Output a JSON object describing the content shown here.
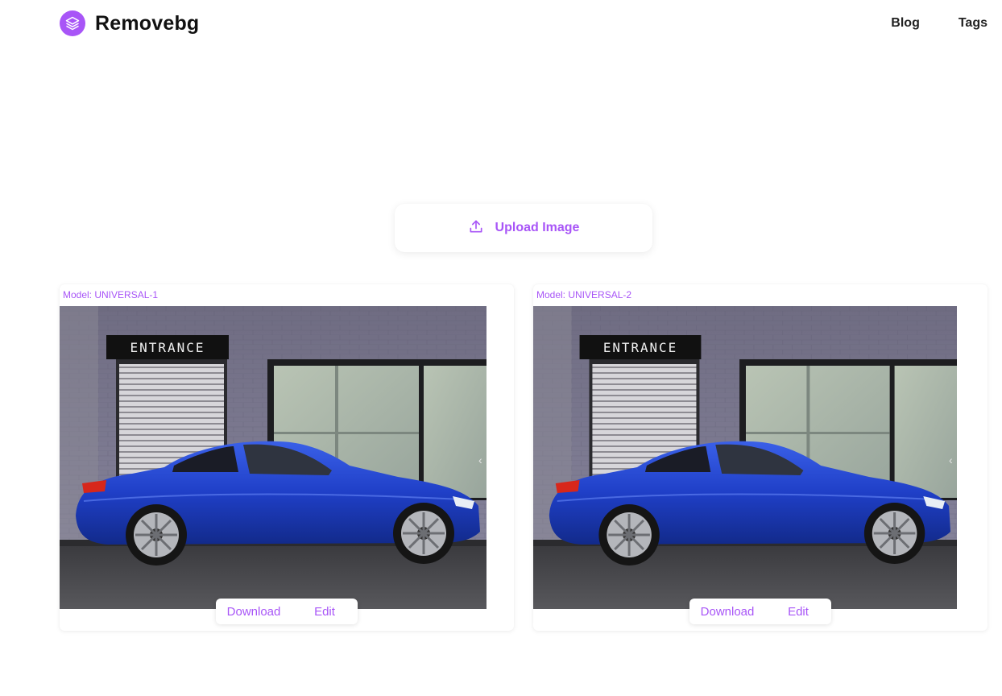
{
  "header": {
    "brand": "Removebg",
    "nav": [
      {
        "label": "Blog"
      },
      {
        "label": "Tags"
      }
    ]
  },
  "upload": {
    "label": "Upload Image",
    "icon": "upload-icon"
  },
  "results": [
    {
      "model_label": "Model: UNIVERSAL-1",
      "sign_text": "ENTRANCE",
      "download_label": "Download",
      "edit_label": "Edit"
    },
    {
      "model_label": "Model: UNIVERSAL-2",
      "sign_text": "ENTRANCE",
      "download_label": "Download",
      "edit_label": "Edit"
    }
  ],
  "colors": {
    "accent": "#a855f7",
    "car": "#1f3fc7",
    "wall": "#7e7c92"
  }
}
